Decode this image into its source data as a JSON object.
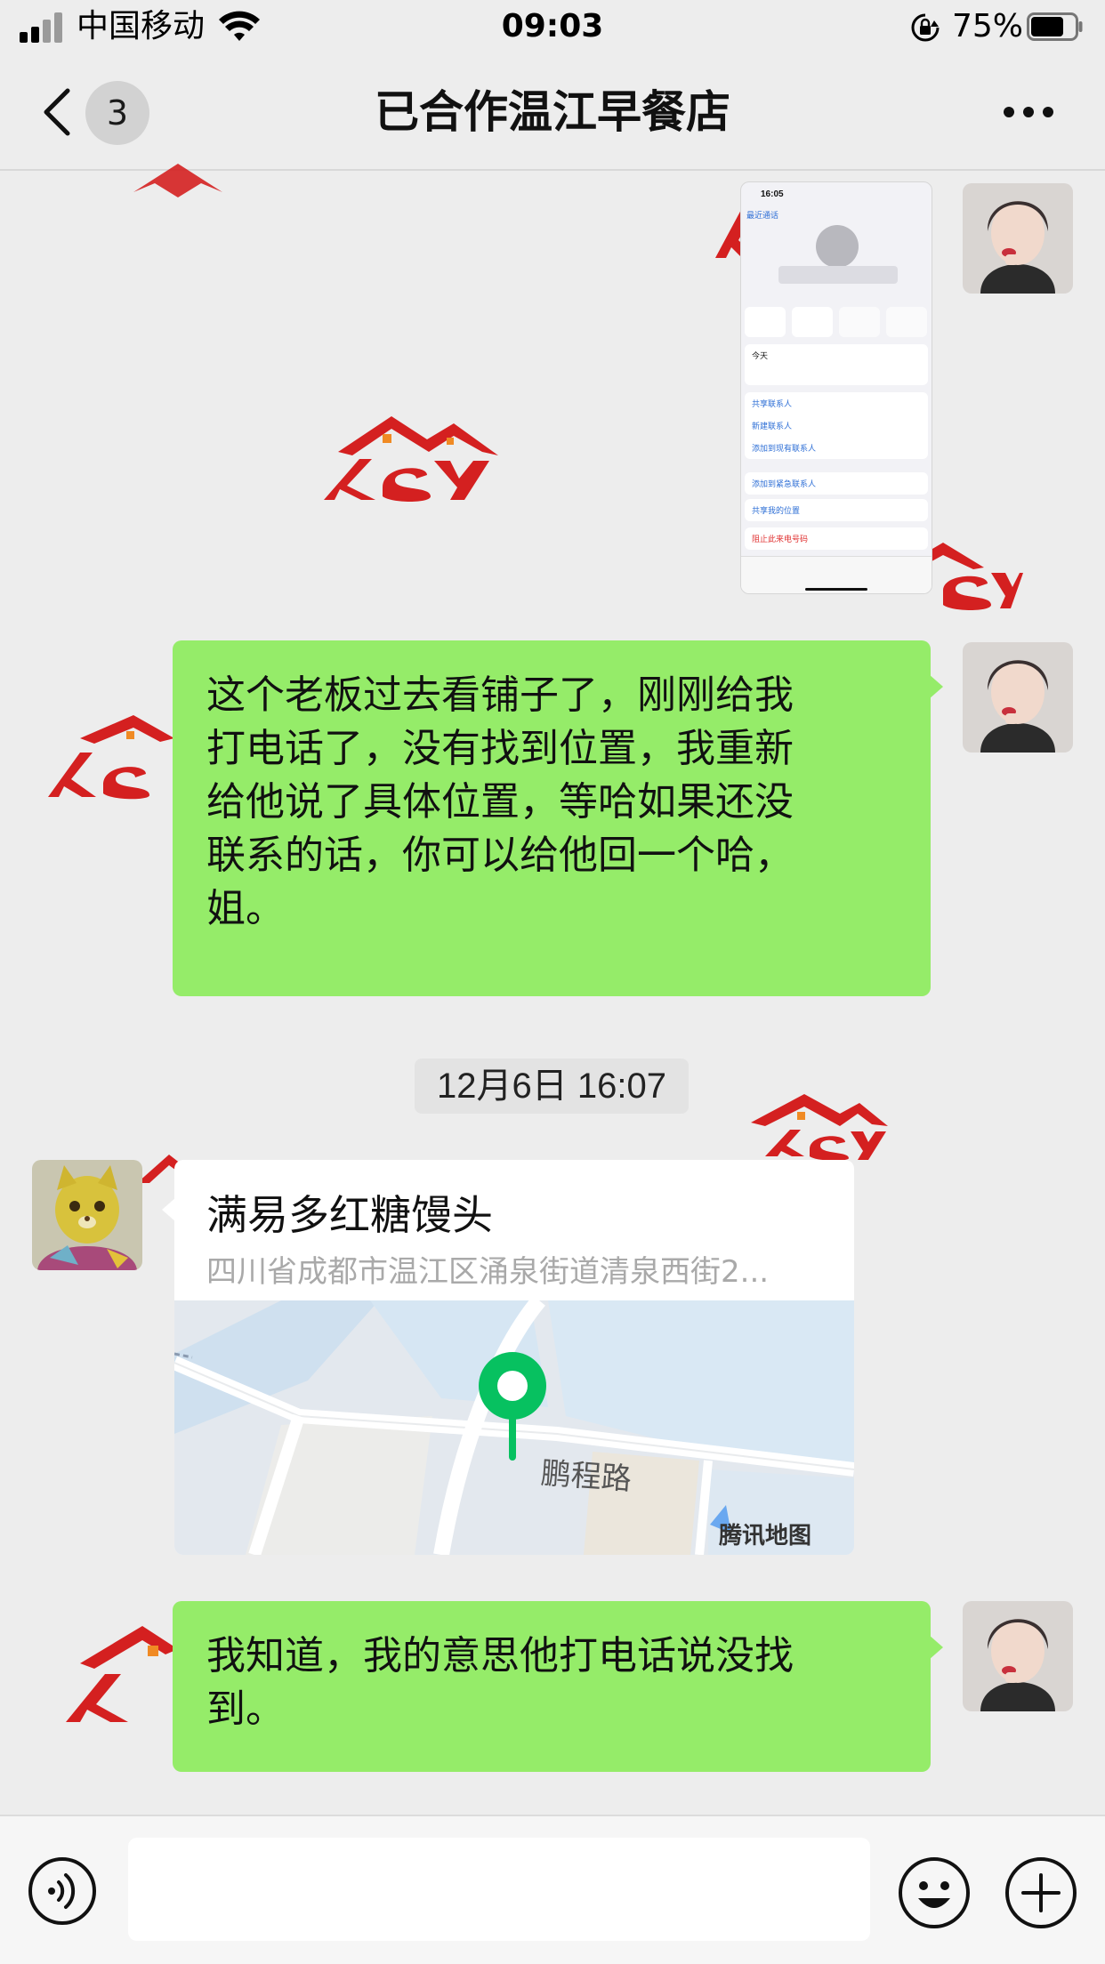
{
  "status_bar": {
    "carrier": "中国移动",
    "time": "09:03",
    "battery_percent": "75%",
    "battery_level": 0.75
  },
  "nav": {
    "back_label": "<",
    "unread_count": "3",
    "title": "已合作温江早餐店",
    "more_label": "..."
  },
  "messages": [
    {
      "type": "image",
      "side": "right",
      "screenshot": {
        "time": "16:05",
        "back": "最近通话",
        "menu_items": [
          "共享联系人",
          "新建联系人",
          "添加到现有联系人",
          "添加到紧急联系人",
          "共享我的位置",
          "阻止此来电号码"
        ],
        "today": "今天"
      }
    },
    {
      "type": "text",
      "side": "right",
      "lines": [
        "这个老板过去看铺子了，刚刚给我",
        "打电话了，没有找到位置，我重新",
        "给他说了具体位置，等哈如果还没",
        "联系的话，你可以给他回一个哈，",
        "姐。"
      ]
    },
    {
      "type": "timestamp",
      "text": "12月6日 16:07"
    },
    {
      "type": "location",
      "side": "left",
      "title": "满易多红糖馒头",
      "address": "四川省成都市温江区涌泉街道清泉西街2...",
      "map_road_label": "鹏程路",
      "map_brand": "腾讯地图"
    },
    {
      "type": "text",
      "side": "right",
      "lines": [
        "我知道，我的意思他打电话说没找",
        "到。"
      ]
    }
  ],
  "colors": {
    "background": "#ededed",
    "bubble_self": "#95ec69",
    "bubble_other": "#ffffff",
    "map_pin": "#07c160",
    "watermark": "#d42020"
  }
}
